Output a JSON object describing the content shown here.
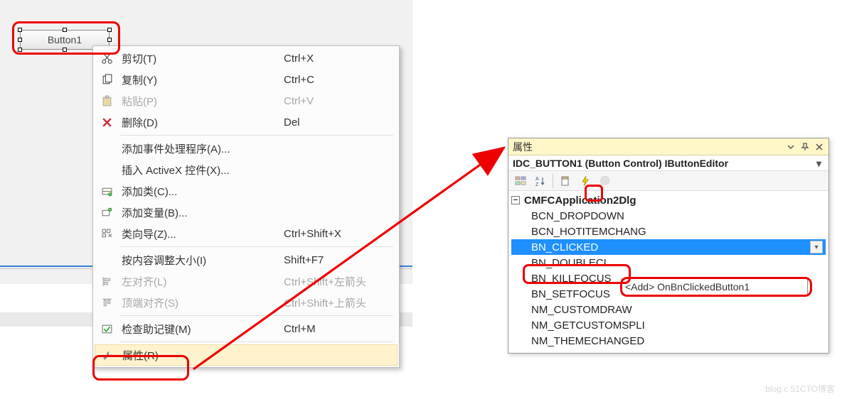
{
  "button": {
    "label": "Button1"
  },
  "contextMenu": {
    "items": [
      {
        "icon": "cut",
        "label": "剪切(T)",
        "shortcut": "Ctrl+X",
        "disabled": false
      },
      {
        "icon": "copy",
        "label": "复制(Y)",
        "shortcut": "Ctrl+C",
        "disabled": false
      },
      {
        "icon": "paste",
        "label": "粘贴(P)",
        "shortcut": "Ctrl+V",
        "disabled": true
      },
      {
        "icon": "delete",
        "label": "删除(D)",
        "shortcut": "Del",
        "disabled": false
      },
      {
        "sep": true
      },
      {
        "icon": "",
        "label": "添加事件处理程序(A)...",
        "shortcut": "",
        "disabled": false
      },
      {
        "icon": "",
        "label": "插入 ActiveX 控件(X)...",
        "shortcut": "",
        "disabled": false
      },
      {
        "icon": "class",
        "label": "添加类(C)...",
        "shortcut": "",
        "disabled": false
      },
      {
        "icon": "var",
        "label": "添加变量(B)...",
        "shortcut": "",
        "disabled": false
      },
      {
        "icon": "wizard",
        "label": "类向导(Z)...",
        "shortcut": "Ctrl+Shift+X",
        "disabled": false
      },
      {
        "sep": true
      },
      {
        "icon": "",
        "label": "按内容调整大小(I)",
        "shortcut": "Shift+F7",
        "disabled": false
      },
      {
        "icon": "align-l",
        "label": "左对齐(L)",
        "shortcut": "Ctrl+Shift+左箭头",
        "disabled": true
      },
      {
        "icon": "align-t",
        "label": "顶端对齐(S)",
        "shortcut": "Ctrl+Shift+上箭头",
        "disabled": true
      },
      {
        "sep": true
      },
      {
        "icon": "check",
        "label": "检查助记键(M)",
        "shortcut": "Ctrl+M",
        "disabled": false
      },
      {
        "sep": true
      },
      {
        "icon": "wrench",
        "label": "属性(R)",
        "shortcut": "",
        "disabled": false,
        "highlight": true
      }
    ]
  },
  "propertiesPanel": {
    "title": "属性",
    "subtitle": "IDC_BUTTON1 (Button Control) IButtonEditor",
    "root": "CMFCApplication2Dlg",
    "events": [
      "BCN_DROPDOWN",
      "BCN_HOTITEMCHANG",
      "BN_CLICKED",
      "BN_DOUBLECL",
      "BN_KILLFOCUS",
      "BN_SETFOCUS",
      "NM_CUSTOMDRAW",
      "NM_GETCUSTOMSPLI",
      "NM_THEMECHANGED"
    ],
    "selectedIndex": 2,
    "addPopup": "<Add> OnBnClickedButton1"
  },
  "watermark": "blog.c  51CTO博客"
}
